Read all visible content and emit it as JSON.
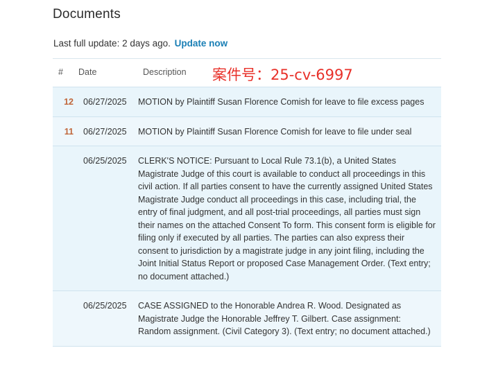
{
  "header": {
    "title": "Documents",
    "update_text": "Last full update: 2 days ago.",
    "update_link": "Update now"
  },
  "overlay_text": "案件号：25-cv-6997",
  "table": {
    "columns": [
      "#",
      "Date",
      "Description"
    ],
    "rows": [
      {
        "number": "12",
        "date": "06/27/2025",
        "description": "MOTION by Plaintiff Susan Florence Comish for leave to file excess pages"
      },
      {
        "number": "11",
        "date": "06/27/2025",
        "description": "MOTION by Plaintiff Susan Florence Comish for leave to file under seal"
      },
      {
        "number": "",
        "date": "06/25/2025",
        "description": "CLERK'S NOTICE: Pursuant to Local Rule 73.1(b), a United States Magistrate Judge of this court is available to conduct all proceedings in this civil action. If all parties consent to have the currently assigned United States Magistrate Judge conduct all proceedings in this case, including trial, the entry of final judgment, and all post-trial proceedings, all parties must sign their names on the attached Consent To form. This consent form is eligible for filing only if executed by all parties. The parties can also express their consent to jurisdiction by a magistrate judge in any joint filing, including the Joint Initial Status Report or proposed Case Management Order. (Text entry; no document attached.)"
      },
      {
        "number": "",
        "date": "06/25/2025",
        "description": "CASE ASSIGNED to the Honorable Andrea R. Wood. Designated as Magistrate Judge the Honorable Jeffrey T. Gilbert. Case assignment: Random assignment. (Civil Category 3). (Text entry; no document attached.)"
      }
    ]
  }
}
